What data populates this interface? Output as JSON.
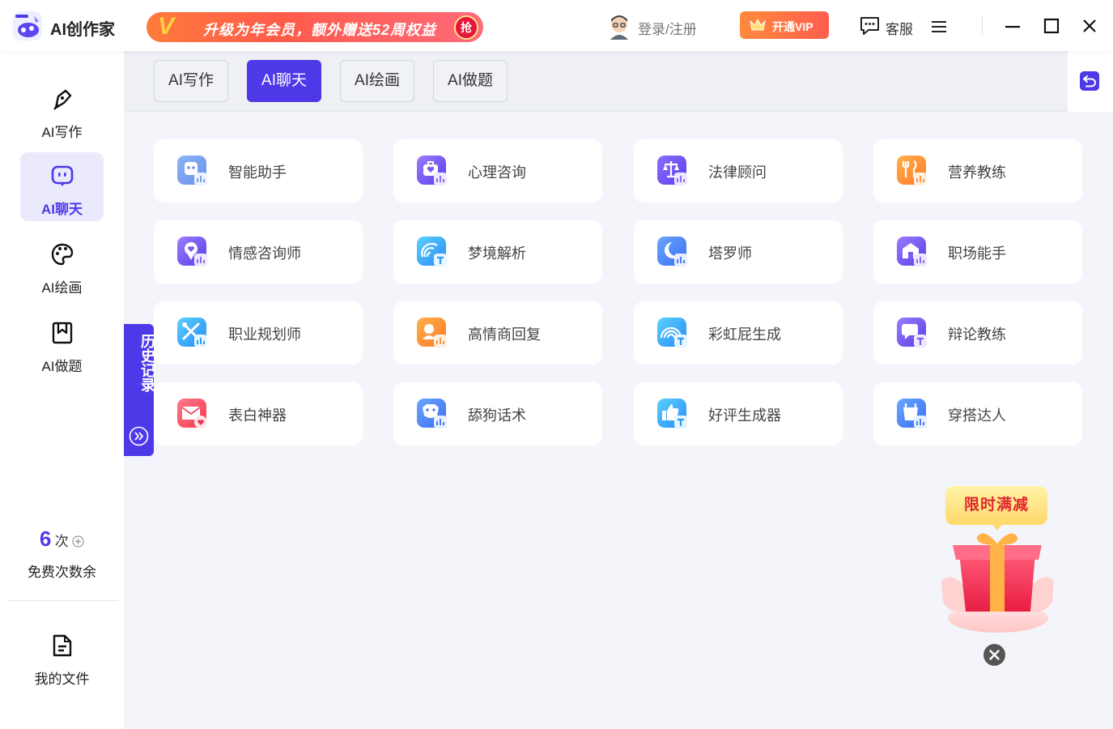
{
  "app": {
    "title": "AI创作家"
  },
  "promo": {
    "v": "V",
    "text": "升级为年会员，额外赠送52周权益",
    "badge": "抢"
  },
  "header": {
    "login_label": "登录/注册",
    "vip_label": "开通VIP",
    "service_label": "客服"
  },
  "sidebar": {
    "items": [
      {
        "label": "AI写作",
        "icon": "pen-icon"
      },
      {
        "label": "AI聊天",
        "icon": "chat-icon"
      },
      {
        "label": "AI绘画",
        "icon": "palette-icon"
      },
      {
        "label": "AI做题",
        "icon": "bookmark-icon"
      }
    ],
    "free_count": "6",
    "free_unit": "次",
    "free_label": "免费次数余",
    "files_label": "我的文件"
  },
  "tabs": [
    {
      "label": "AI写作"
    },
    {
      "label": "AI聊天"
    },
    {
      "label": "AI绘画"
    },
    {
      "label": "AI做题"
    }
  ],
  "active_tab": "AI聊天",
  "history": {
    "label": "历史记录"
  },
  "cards": [
    {
      "label": "智能助手"
    },
    {
      "label": "心理咨询"
    },
    {
      "label": "法律顾问"
    },
    {
      "label": "营养教练"
    },
    {
      "label": "情感咨询师"
    },
    {
      "label": "梦境解析"
    },
    {
      "label": "塔罗师"
    },
    {
      "label": "职场能手"
    },
    {
      "label": "职业规划师"
    },
    {
      "label": "高情商回复"
    },
    {
      "label": "彩虹屁生成"
    },
    {
      "label": "辩论教练"
    },
    {
      "label": "表白神器"
    },
    {
      "label": "舔狗话术"
    },
    {
      "label": "好评生成器"
    },
    {
      "label": "穿搭达人"
    }
  ],
  "gift": {
    "tag": "限时满减"
  },
  "colors": {
    "accent": "#4e39e8",
    "vip": "#ff6a3d",
    "background": "#f3f5fb"
  }
}
